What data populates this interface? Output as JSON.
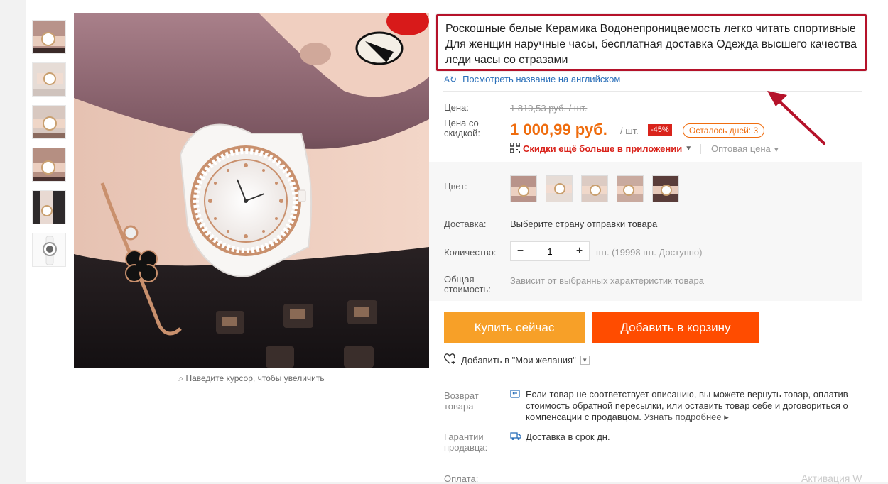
{
  "product": {
    "title": "Роскошные белые Керамика Водонепроницаемость легко читать спортивные Для женщин наручные часы, бесплатная доставка Одежда высшего качества леди часы со стразами",
    "translate_link": "Посмотреть название на английском",
    "zoom_hint": "Наведите курсор, чтобы увеличить"
  },
  "price": {
    "label": "Цена:",
    "old": "1 819,53 руб. / шт.",
    "sale_label": "Цена со скидкой:",
    "sale": "1 000,99 руб.",
    "unit": "/ шт.",
    "discount": "-45%",
    "days_left": "Осталось дней: 3",
    "app_promo": "Скидки ещё больше в приложении",
    "wholesale": "Оптовая цена"
  },
  "options": {
    "color_label": "Цвет:",
    "shipping_label": "Доставка:",
    "shipping_value": "Выберите страну отправки товара",
    "qty_label": "Количество:",
    "qty_value": "1",
    "qty_minus": "−",
    "qty_plus": "+",
    "availability": "шт. (19998 шт. Доступно)",
    "total_label": "Общая стоимость:",
    "total_value": "Зависит от выбранных характеристик товара"
  },
  "actions": {
    "buy_now": "Купить сейчас",
    "add_to_cart": "Добавить в корзину",
    "wishlist": "Добавить в \"Мои желания\""
  },
  "policies": {
    "return_label": "Возврат товара",
    "return_text": "Если товар не соответствует описанию, вы можете вернуть товар, оплатив стоимость обратной пересылки, или оставить товар себе и договориться о компенсации с продавцом.",
    "return_more": "Узнать подробнее",
    "guarantee_label": "Гарантии продавца:",
    "guarantee_text": "Доставка в срок дн.",
    "payment_label": "Оплата:"
  },
  "watermark": "Активация W",
  "colors": {
    "accent_orange": "#ff4c00",
    "buy_orange": "#f7a028",
    "price_orange": "#ef6d0f",
    "annotation_red": "#b5122a",
    "link_blue": "#2a6fb9"
  }
}
